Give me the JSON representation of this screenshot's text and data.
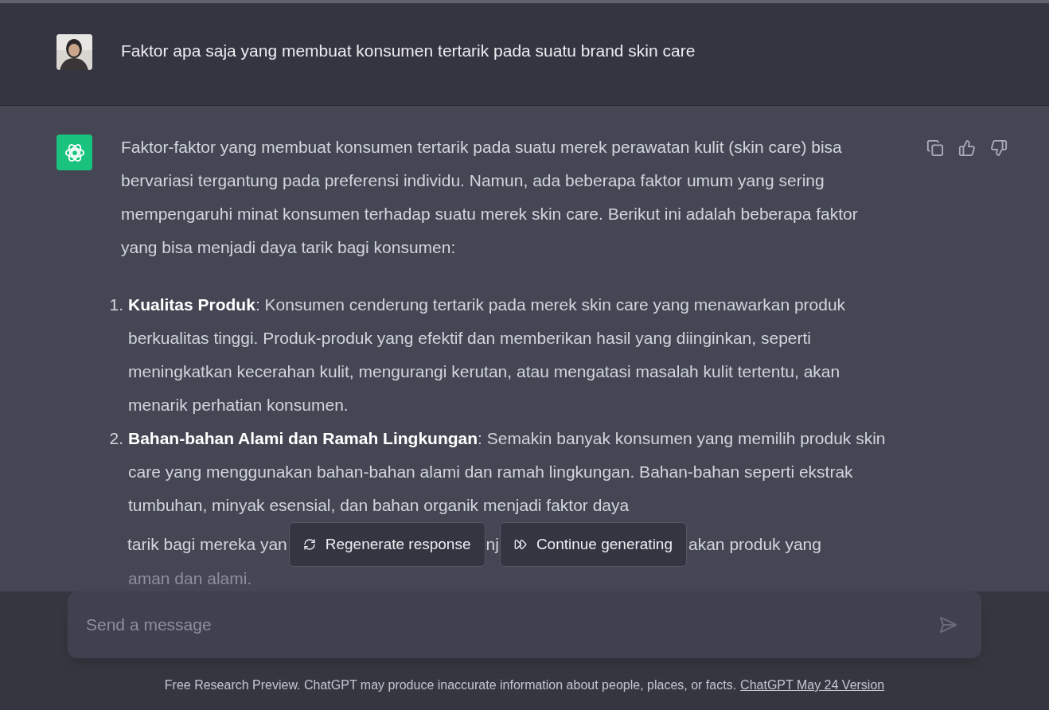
{
  "user_message": {
    "text": "Faktor apa saja yang membuat konsumen tertarik pada suatu brand skin care"
  },
  "assistant_message": {
    "intro": "Faktor-faktor yang membuat konsumen tertarik pada suatu merek perawatan kulit (skin care) bisa bervariasi tergantung pada preferensi individu. Namun, ada beberapa faktor umum yang sering mempengaruhi minat konsumen terhadap suatu merek skin care. Berikut ini adalah beberapa faktor yang bisa menjadi daya tarik bagi konsumen:",
    "items": [
      {
        "number": "1.",
        "title": "Kualitas Produk",
        "text": ": Konsumen cenderung tertarik pada merek skin care yang menawarkan produk berkualitas tinggi. Produk-produk yang efektif dan memberikan hasil yang diinginkan, seperti meningkatkan kecerahan kulit, mengurangi kerutan, atau mengatasi masalah kulit tertentu, akan menarik perhatian konsumen."
      },
      {
        "number": "2.",
        "title": "Bahan-bahan Alami dan Ramah Lingkungan",
        "text": ": Semakin banyak konsumen yang memilih produk skin care yang menggunakan bahan-bahan alami dan ramah lingkungan. Bahan-bahan seperti ekstrak tumbuhan, minyak esensial, dan bahan organik menjadi faktor daya",
        "covered_line": [
          "tarik bagi mereka yan",
          "nj",
          "akan produk yang"
        ],
        "faded_line": "aman dan alami."
      }
    ]
  },
  "actions": [
    {
      "kind": "regenerate",
      "label": "Regenerate response"
    },
    {
      "kind": "continue",
      "label": "Continue generating"
    }
  ],
  "composer": {
    "placeholder": "Send a message"
  },
  "footer": {
    "text": "Free Research Preview. ChatGPT may produce inaccurate information about people, places, or facts.",
    "link": "ChatGPT May 24 Version"
  }
}
